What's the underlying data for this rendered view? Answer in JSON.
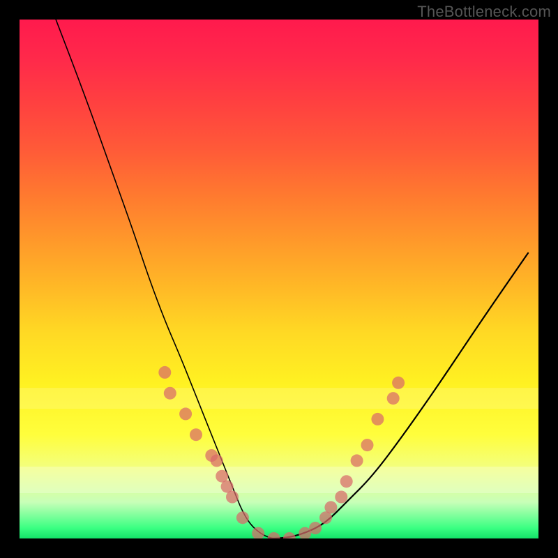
{
  "watermark": "TheBottleneck.com",
  "chart_data": {
    "type": "line",
    "title": "",
    "xlabel": "",
    "ylabel": "",
    "xlim": [
      0,
      100
    ],
    "ylim": [
      0,
      100
    ],
    "series": [
      {
        "name": "bottleneck-curve",
        "x": [
          7,
          12,
          17,
          22,
          25,
          28,
          31,
          33,
          35,
          37,
          39,
          41,
          43,
          45,
          48,
          51,
          55,
          59,
          63,
          68,
          74,
          81,
          89,
          98
        ],
        "y": [
          100,
          87,
          73,
          59,
          50,
          42,
          35,
          30,
          25,
          20,
          15,
          10,
          5,
          2,
          0,
          0,
          1,
          3,
          7,
          12,
          20,
          30,
          42,
          55
        ]
      }
    ],
    "points": [
      {
        "name": "p1",
        "x": 28,
        "y": 32
      },
      {
        "name": "p2",
        "x": 29,
        "y": 28
      },
      {
        "name": "p3",
        "x": 32,
        "y": 24
      },
      {
        "name": "p4",
        "x": 34,
        "y": 20
      },
      {
        "name": "p5",
        "x": 37,
        "y": 16
      },
      {
        "name": "p6",
        "x": 38,
        "y": 15
      },
      {
        "name": "p7",
        "x": 39,
        "y": 12
      },
      {
        "name": "p8",
        "x": 40,
        "y": 10
      },
      {
        "name": "p9",
        "x": 41,
        "y": 8
      },
      {
        "name": "p10",
        "x": 43,
        "y": 4
      },
      {
        "name": "p11",
        "x": 46,
        "y": 1
      },
      {
        "name": "p12",
        "x": 49,
        "y": 0
      },
      {
        "name": "p13",
        "x": 52,
        "y": 0
      },
      {
        "name": "p14",
        "x": 55,
        "y": 1
      },
      {
        "name": "p15",
        "x": 57,
        "y": 2
      },
      {
        "name": "p16",
        "x": 59,
        "y": 4
      },
      {
        "name": "p17",
        "x": 60,
        "y": 6
      },
      {
        "name": "p18",
        "x": 62,
        "y": 8
      },
      {
        "name": "p19",
        "x": 63,
        "y": 11
      },
      {
        "name": "p20",
        "x": 65,
        "y": 15
      },
      {
        "name": "p21",
        "x": 67,
        "y": 18
      },
      {
        "name": "p22",
        "x": 69,
        "y": 23
      },
      {
        "name": "p23",
        "x": 72,
        "y": 27
      },
      {
        "name": "p24",
        "x": 73,
        "y": 30
      }
    ],
    "point_radius": 9,
    "gradient_stops": [
      {
        "pos": 0,
        "color": "#ff1a4d"
      },
      {
        "pos": 50,
        "color": "#ffcc22"
      },
      {
        "pos": 80,
        "color": "#ffff3c"
      },
      {
        "pos": 100,
        "color": "#13e268"
      }
    ]
  }
}
